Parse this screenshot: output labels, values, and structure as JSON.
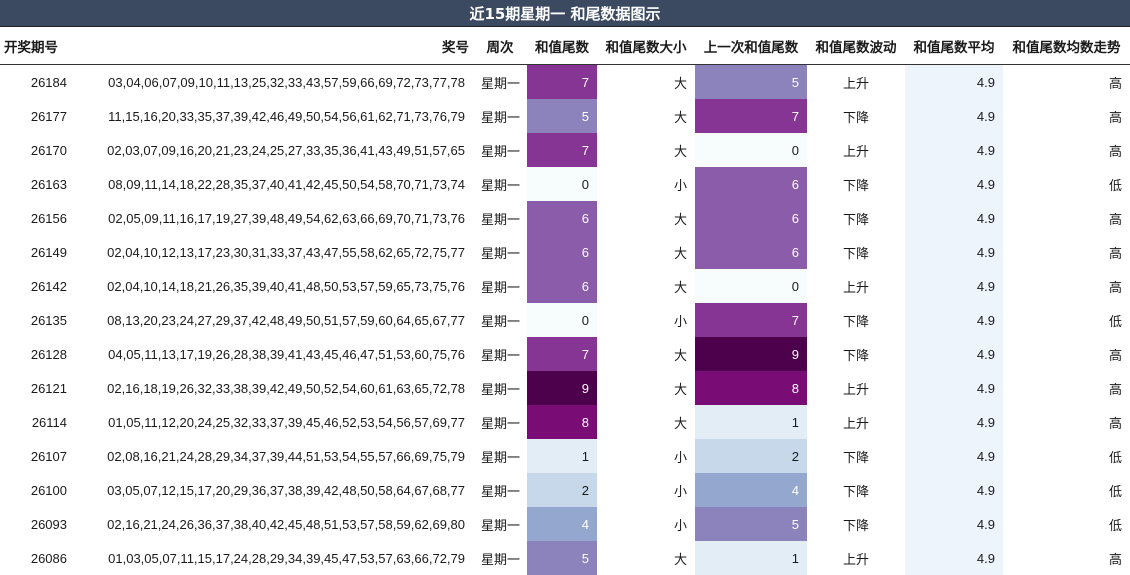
{
  "title": "近15期星期一 和尾数据图示",
  "headers": [
    "开奖期号",
    "奖号",
    "周次",
    "和值尾数",
    "和值尾数大小",
    "上一次和值尾数",
    "和值尾数波动",
    "和值尾数平均",
    "和值尾数均数走势"
  ],
  "colors": {
    "header_bg": "#3b4a60",
    "heat_low": "#f7fcfd",
    "heat_high": "#4d004b"
  },
  "chart_data": {
    "type": "table",
    "title": "近15期星期一 和尾数据图示",
    "columns": [
      "开奖期号",
      "奖号",
      "周次",
      "和值尾数",
      "和值尾数大小",
      "上一次和值尾数",
      "和值尾数波动",
      "和值尾数平均",
      "和值尾数均数走势"
    ],
    "heat_scale": {
      "min": 0,
      "max": 9
    },
    "rows": [
      {
        "issue": "26184",
        "numbers": "03,04,06,07,09,10,11,13,25,32,33,43,57,59,66,69,72,73,77,78",
        "weekday": "星期一",
        "tail": 7,
        "size": "大",
        "prev": 5,
        "wave": "上升",
        "avg": "4.9",
        "trend": "高"
      },
      {
        "issue": "26177",
        "numbers": "11,15,16,20,33,35,37,39,42,46,49,50,54,56,61,62,71,73,76,79",
        "weekday": "星期一",
        "tail": 5,
        "size": "大",
        "prev": 7,
        "wave": "下降",
        "avg": "4.9",
        "trend": "高"
      },
      {
        "issue": "26170",
        "numbers": "02,03,07,09,16,20,21,23,24,25,27,33,35,36,41,43,49,51,57,65",
        "weekday": "星期一",
        "tail": 7,
        "size": "大",
        "prev": 0,
        "wave": "上升",
        "avg": "4.9",
        "trend": "高"
      },
      {
        "issue": "26163",
        "numbers": "08,09,11,14,18,22,28,35,37,40,41,42,45,50,54,58,70,71,73,74",
        "weekday": "星期一",
        "tail": 0,
        "size": "小",
        "prev": 6,
        "wave": "下降",
        "avg": "4.9",
        "trend": "低"
      },
      {
        "issue": "26156",
        "numbers": "02,05,09,11,16,17,19,27,39,48,49,54,62,63,66,69,70,71,73,76",
        "weekday": "星期一",
        "tail": 6,
        "size": "大",
        "prev": 6,
        "wave": "下降",
        "avg": "4.9",
        "trend": "高"
      },
      {
        "issue": "26149",
        "numbers": "02,04,10,12,13,17,23,30,31,33,37,43,47,55,58,62,65,72,75,77",
        "weekday": "星期一",
        "tail": 6,
        "size": "大",
        "prev": 6,
        "wave": "下降",
        "avg": "4.9",
        "trend": "高"
      },
      {
        "issue": "26142",
        "numbers": "02,04,10,14,18,21,26,35,39,40,41,48,50,53,57,59,65,73,75,76",
        "weekday": "星期一",
        "tail": 6,
        "size": "大",
        "prev": 0,
        "wave": "上升",
        "avg": "4.9",
        "trend": "高"
      },
      {
        "issue": "26135",
        "numbers": "08,13,20,23,24,27,29,37,42,48,49,50,51,57,59,60,64,65,67,77",
        "weekday": "星期一",
        "tail": 0,
        "size": "小",
        "prev": 7,
        "wave": "下降",
        "avg": "4.9",
        "trend": "低"
      },
      {
        "issue": "26128",
        "numbers": "04,05,11,13,17,19,26,28,38,39,41,43,45,46,47,51,53,60,75,76",
        "weekday": "星期一",
        "tail": 7,
        "size": "大",
        "prev": 9,
        "wave": "下降",
        "avg": "4.9",
        "trend": "高"
      },
      {
        "issue": "26121",
        "numbers": "02,16,18,19,26,32,33,38,39,42,49,50,52,54,60,61,63,65,72,78",
        "weekday": "星期一",
        "tail": 9,
        "size": "大",
        "prev": 8,
        "wave": "上升",
        "avg": "4.9",
        "trend": "高"
      },
      {
        "issue": "26114",
        "numbers": "01,05,11,12,20,24,25,32,33,37,39,45,46,52,53,54,56,57,69,77",
        "weekday": "星期一",
        "tail": 8,
        "size": "大",
        "prev": 1,
        "wave": "上升",
        "avg": "4.9",
        "trend": "高"
      },
      {
        "issue": "26107",
        "numbers": "02,08,16,21,24,28,29,34,37,39,44,51,53,54,55,57,66,69,75,79",
        "weekday": "星期一",
        "tail": 1,
        "size": "小",
        "prev": 2,
        "wave": "下降",
        "avg": "4.9",
        "trend": "低"
      },
      {
        "issue": "26100",
        "numbers": "03,05,07,12,15,17,20,29,36,37,38,39,42,48,50,58,64,67,68,77",
        "weekday": "星期一",
        "tail": 2,
        "size": "小",
        "prev": 4,
        "wave": "下降",
        "avg": "4.9",
        "trend": "低"
      },
      {
        "issue": "26093",
        "numbers": "02,16,21,24,26,36,37,38,40,42,45,48,51,53,57,58,59,62,69,80",
        "weekday": "星期一",
        "tail": 4,
        "size": "小",
        "prev": 5,
        "wave": "下降",
        "avg": "4.9",
        "trend": "低"
      },
      {
        "issue": "26086",
        "numbers": "01,03,05,07,11,15,17,24,28,29,34,39,45,47,53,57,63,66,72,79",
        "weekday": "星期一",
        "tail": 5,
        "size": "大",
        "prev": 1,
        "wave": "上升",
        "avg": "4.9",
        "trend": "高"
      }
    ]
  }
}
